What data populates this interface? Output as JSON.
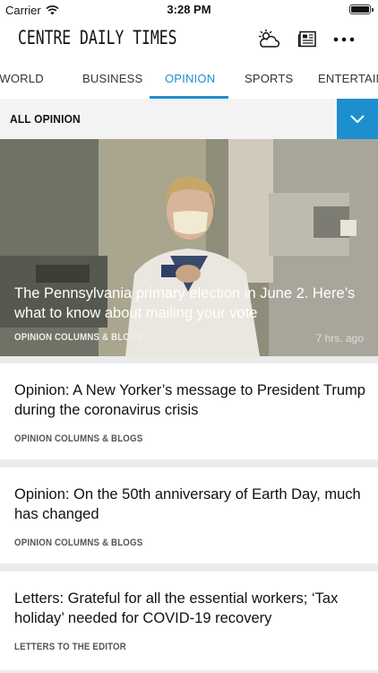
{
  "status": {
    "carrier": "Carrier",
    "time": "3:28 PM"
  },
  "header": {
    "logo": "CENTRE DAILY TIMES"
  },
  "tabs": [
    {
      "label": "N/WORLD"
    },
    {
      "label": "BUSINESS"
    },
    {
      "label": "OPINION"
    },
    {
      "label": "SPORTS"
    },
    {
      "label": "ENTERTAINMENT"
    }
  ],
  "section": {
    "title": "ALL OPINION"
  },
  "hero": {
    "title": "The Pennsylvania primary election in June 2. Here’s what to know about mailing your vote",
    "category": "OPINION COLUMNS & BLOGS",
    "time": "7 hrs. ago"
  },
  "articles": [
    {
      "title": "Opinion: A New Yorker’s message to President Trump during the coronavirus crisis",
      "category": "OPINION COLUMNS & BLOGS"
    },
    {
      "title": "Opinion: On the 50th anniversary of Earth Day, much has changed",
      "category": "OPINION COLUMNS & BLOGS"
    },
    {
      "title": "Letters: Grateful for all the essential workers; ‘Tax holiday’ needed for COVID-19 recovery",
      "category": "LETTERS TO THE EDITOR"
    }
  ],
  "colors": {
    "accent": "#1d8fcf"
  },
  "icons": [
    "wifi-icon",
    "battery-icon",
    "weather-icon",
    "newspaper-icon",
    "more-icon",
    "chevron-down-icon"
  ]
}
